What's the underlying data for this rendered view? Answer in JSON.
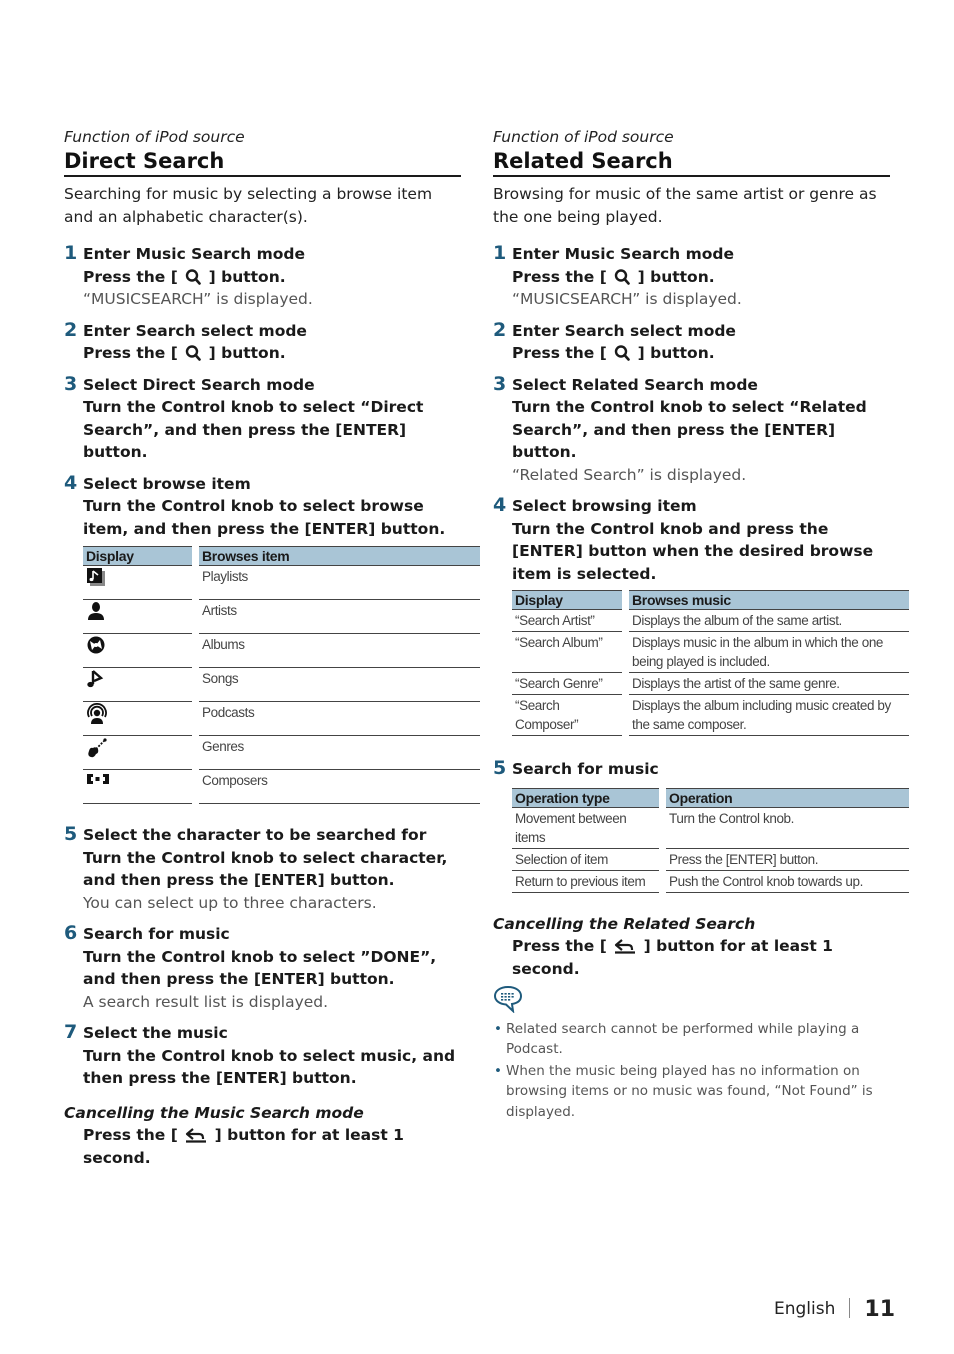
{
  "left": {
    "kicker": "Function of iPod source",
    "title": "Direct Search",
    "intro": "Searching for music by selecting a browse item and an alphabetic character(s).",
    "steps": [
      {
        "num": "1",
        "title": "Enter Music Search mode",
        "instr_pre": "Press the [",
        "icon": "search-icon",
        "instr_post": "] button.",
        "note": "“MUSICSEARCH” is displayed."
      },
      {
        "num": "2",
        "title": "Enter Search select mode",
        "instr_pre": "Press the [",
        "icon": "search-icon",
        "instr_post": "] button."
      },
      {
        "num": "3",
        "title": "Select Direct Search mode",
        "instr": "Turn the Control knob to select “Direct Search”, and then press the [ENTER] button."
      },
      {
        "num": "4",
        "title": "Select browse item",
        "instr": "Turn the Control knob to select browse item, and then press the [ENTER] button."
      },
      {
        "num": "5",
        "title": "Select the character to be searched for",
        "instr": "Turn the Control knob to select character, and then press the [ENTER] button.",
        "note": "You can select up to three characters."
      },
      {
        "num": "6",
        "title": "Search for music",
        "instr": "Turn the Control knob to select ”DONE”, and then press the [ENTER] button.",
        "note": "A search result list is displayed."
      },
      {
        "num": "7",
        "title": "Select the music",
        "instr": "Turn the Control knob to select music, and then press the [ENTER] button."
      }
    ],
    "browse_table": {
      "headers": [
        "Display",
        "Browses item"
      ],
      "rows": [
        {
          "icon": "playlist-icon",
          "label": "Playlists"
        },
        {
          "icon": "artist-icon",
          "label": "Artists"
        },
        {
          "icon": "album-icon",
          "label": "Albums"
        },
        {
          "icon": "song-icon",
          "label": "Songs"
        },
        {
          "icon": "podcast-icon",
          "label": "Podcasts"
        },
        {
          "icon": "genre-icon",
          "label": "Genres"
        },
        {
          "icon": "composer-icon",
          "label": "Composers"
        }
      ]
    },
    "cancel": {
      "title": "Cancelling the Music Search mode",
      "instr_pre": "Press the [",
      "icon": "back-icon",
      "instr_post": "] button for at least 1 second."
    }
  },
  "right": {
    "kicker": "Function of iPod source",
    "title": "Related Search",
    "intro": "Browsing for music of the same artist or genre as the one being played.",
    "steps": [
      {
        "num": "1",
        "title": "Enter Music Search mode",
        "instr_pre": "Press the [",
        "icon": "search-icon",
        "instr_post": "] button.",
        "note": "“MUSICSEARCH” is displayed."
      },
      {
        "num": "2",
        "title": "Enter Search select mode",
        "instr_pre": "Press the [",
        "icon": "search-icon",
        "instr_post": "] button."
      },
      {
        "num": "3",
        "title": "Select Related Search mode",
        "instr": "Turn the Control knob to select “Related Search”, and then press the [ENTER] button.",
        "note": "“Related Search” is displayed."
      },
      {
        "num": "4",
        "title": "Select browsing item",
        "instr": "Turn the Control knob and press the [ENTER] button when the desired browse item is selected."
      },
      {
        "num": "5",
        "title": "Search for music"
      }
    ],
    "related_table": {
      "headers": [
        "Display",
        "Browses music"
      ],
      "rows": [
        [
          "“Search Artist”",
          "Displays the album of the same artist."
        ],
        [
          "“Search Album”",
          "Displays music in the album in which the one being played is included."
        ],
        [
          "“Search Genre”",
          "Displays the artist of the same genre."
        ],
        [
          "“Search Composer”",
          "Displays the album including music created by the same composer."
        ]
      ]
    },
    "ops_table": {
      "headers": [
        "Operation type",
        "Operation"
      ],
      "rows": [
        [
          "Movement between items",
          "Turn the Control knob."
        ],
        [
          "Selection of item",
          "Press the [ENTER] button."
        ],
        [
          "Return to previous item",
          "Push the Control knob towards up."
        ]
      ]
    },
    "cancel": {
      "title": "Cancelling the Related Search",
      "instr_pre": "Press the [",
      "icon": "back-icon",
      "instr_post": "] button for at least 1 second."
    },
    "notes": [
      "Related search cannot be performed while playing a Podcast.",
      "When the music being played has no information on browsing items or no music was found, “Not Found” is displayed."
    ]
  },
  "footer": {
    "language": "English",
    "page_number": "11"
  },
  "colors": {
    "step_number": "#1e5a7c",
    "table_header": "#a9c5d6"
  }
}
